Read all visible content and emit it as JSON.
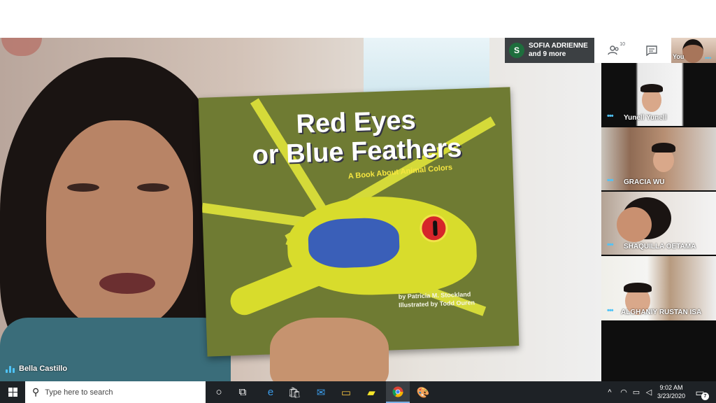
{
  "meeting": {
    "participants_pill": {
      "avatar_letter": "S",
      "line1": "SOFIA ADRIENNE",
      "line2": "and 9 more"
    },
    "people_count": "10",
    "self_label": "You",
    "presenter": {
      "name": "Bella Castillo"
    },
    "tiles": [
      {
        "name": "Yunell Yunell"
      },
      {
        "name": "GRACIA WU"
      },
      {
        "name": "SHAQUILLA OETAMA"
      },
      {
        "name": "ALGHANIY RUSTAN ISA"
      }
    ]
  },
  "book": {
    "title_line1": "Red Eyes",
    "title_line2": "or Blue Feathers",
    "subtitle": "A Book About Animal Colors",
    "author": "by Patricia M. Stockland",
    "illustrator": "Illustrated by Todd Ouren"
  },
  "taskbar": {
    "search_placeholder": "Type here to search",
    "time": "9:02 AM",
    "date": "3/23/2020",
    "notification_count": "7"
  },
  "colors": {
    "accent_blue": "#4fc3f7",
    "avatar_green": "#1e6e3d",
    "taskbar_bg": "#1e2226"
  }
}
